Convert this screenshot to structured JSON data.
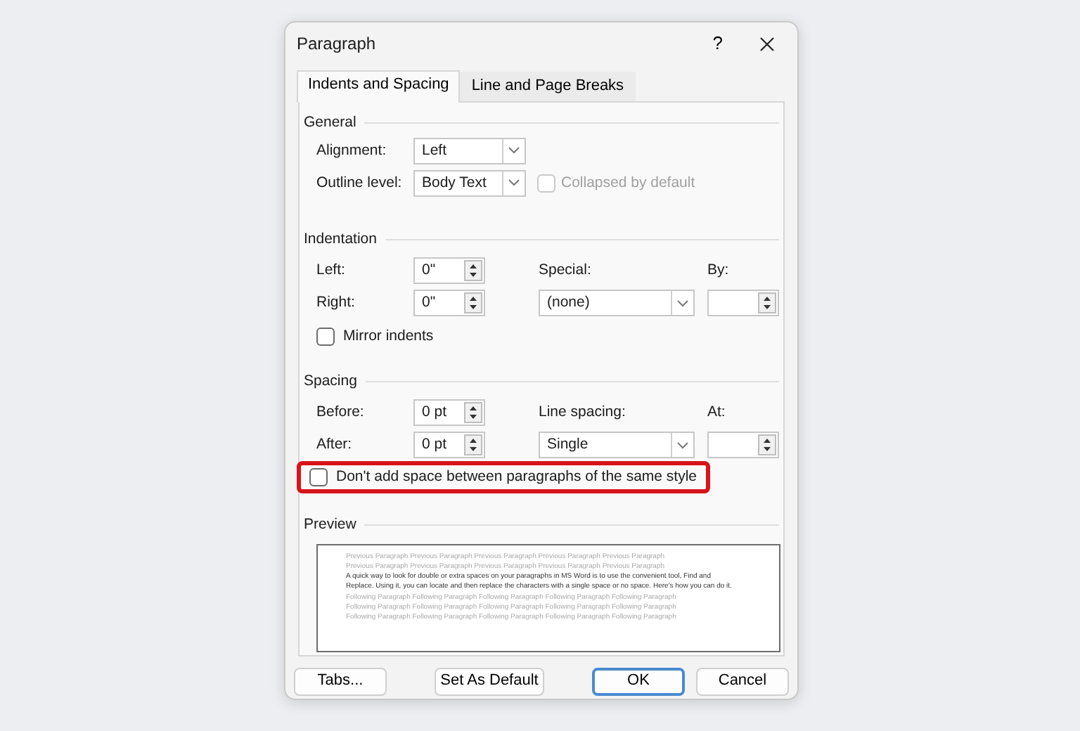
{
  "window": {
    "title": "Paragraph",
    "help_button": "?"
  },
  "tabs": [
    {
      "label": "Indents and Spacing",
      "selected": true
    },
    {
      "label": "Line and Page Breaks",
      "selected": false
    }
  ],
  "general": {
    "heading": "General",
    "alignment": {
      "label": "Alignment:",
      "value": "Left"
    },
    "outline_level": {
      "label": "Outline level:",
      "value": "Body Text"
    },
    "collapsed": {
      "label": "Collapsed by default",
      "checked": false,
      "disabled": true
    }
  },
  "indentation": {
    "heading": "Indentation",
    "left": {
      "label": "Left:",
      "value": "0\""
    },
    "right": {
      "label": "Right:",
      "value": "0\""
    },
    "special": {
      "label": "Special:",
      "value": "(none)"
    },
    "by": {
      "label": "By:"
    },
    "mirror_indents": {
      "label": "Mirror indents",
      "checked": false
    }
  },
  "spacing": {
    "heading": "Spacing",
    "before": {
      "label": "Before:",
      "value": "0 pt"
    },
    "after": {
      "label": "After:",
      "value": "0 pt"
    },
    "line_spacing": {
      "label": "Line spacing:",
      "value": "Single"
    },
    "at": {
      "label": "At:"
    },
    "dont_add_space": {
      "label": "Don't add space between paragraphs of the same style",
      "checked": false,
      "highlighted": true
    }
  },
  "preview": {
    "heading": "Preview",
    "previous_lines": [
      "Previous Paragraph Previous Paragraph Previous Paragraph Previous Paragraph Previous Paragraph",
      "Previous Paragraph Previous Paragraph Previous Paragraph Previous Paragraph Previous Paragraph"
    ],
    "sample": "A quick way to look for double or extra spaces on your paragraphs in MS Word is to use the convenient tool, Find and Replace. Using it, you can locate and then replace the characters with a single space or no space. Here's how you can do it.",
    "following_lines": [
      "Following Paragraph Following Paragraph Following Paragraph Following Paragraph Following Paragraph",
      "Following Paragraph Following Paragraph Following Paragraph Following Paragraph Following Paragraph",
      "Following Paragraph Following Paragraph Following Paragraph Following Paragraph Following Paragraph"
    ]
  },
  "buttons": [
    {
      "label": "Tabs...",
      "default": false
    },
    {
      "label": "Set As Default",
      "default": false
    },
    {
      "label": "OK",
      "default": true
    },
    {
      "label": "Cancel",
      "default": false
    }
  ]
}
